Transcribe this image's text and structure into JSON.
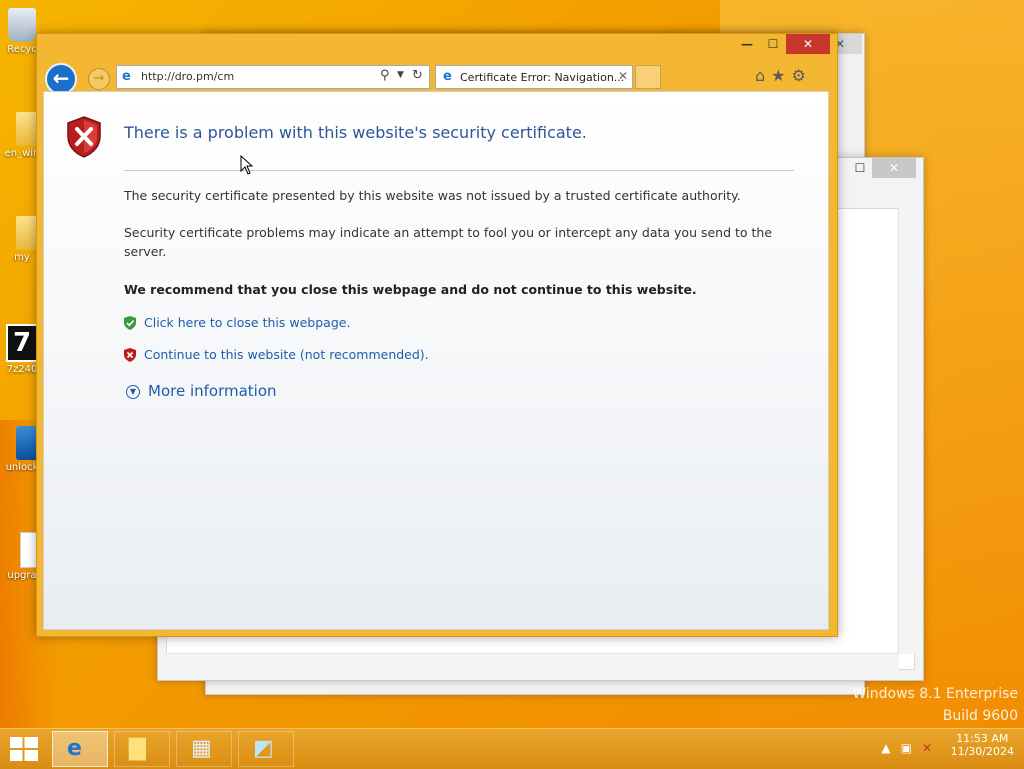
{
  "desktop": {
    "icons": [
      {
        "label": "Recyc"
      },
      {
        "label": "en_win"
      },
      {
        "label": "my"
      },
      {
        "label": "7z240"
      },
      {
        "label": "unlock"
      },
      {
        "label": "upgra"
      }
    ],
    "watermark_line1": "Windows 8.1 Enterprise",
    "watermark_line2": "Build 9600"
  },
  "ie": {
    "address_url": "http://dro.pm/cm",
    "tab_title": "Certificate Error: Navigation...",
    "tab_close": "✕",
    "window_controls": {
      "minimize": "—",
      "maximize": "☐",
      "close": "✕"
    },
    "icons": [
      "back-icon",
      "forward-icon",
      "search-icon",
      "refresh-icon",
      "home-icon",
      "favorites-icon",
      "settings-icon"
    ]
  },
  "page": {
    "headline": "There is a problem with this website's security certificate.",
    "para1": "The security certificate presented by this website was not issued by a trusted certificate authority.",
    "para2": "Security certificate problems may indicate an attempt to fool you or intercept any data you send to the server.",
    "recommend": "We recommend that you close this webpage and do not continue to this website.",
    "link_close": "Click here to close this webpage.",
    "link_continue": "Continue to this website (not recommended).",
    "more_info": "More information"
  },
  "taskbar": {
    "time": "11:53 AM",
    "date": "11/30/2024"
  },
  "colors": {
    "accent_blue": "#1a6fc9",
    "link_blue": "#1c5fa8",
    "headline_blue": "#2b579a",
    "ie_frame": "#f3b731",
    "close_red": "#c7372c"
  }
}
